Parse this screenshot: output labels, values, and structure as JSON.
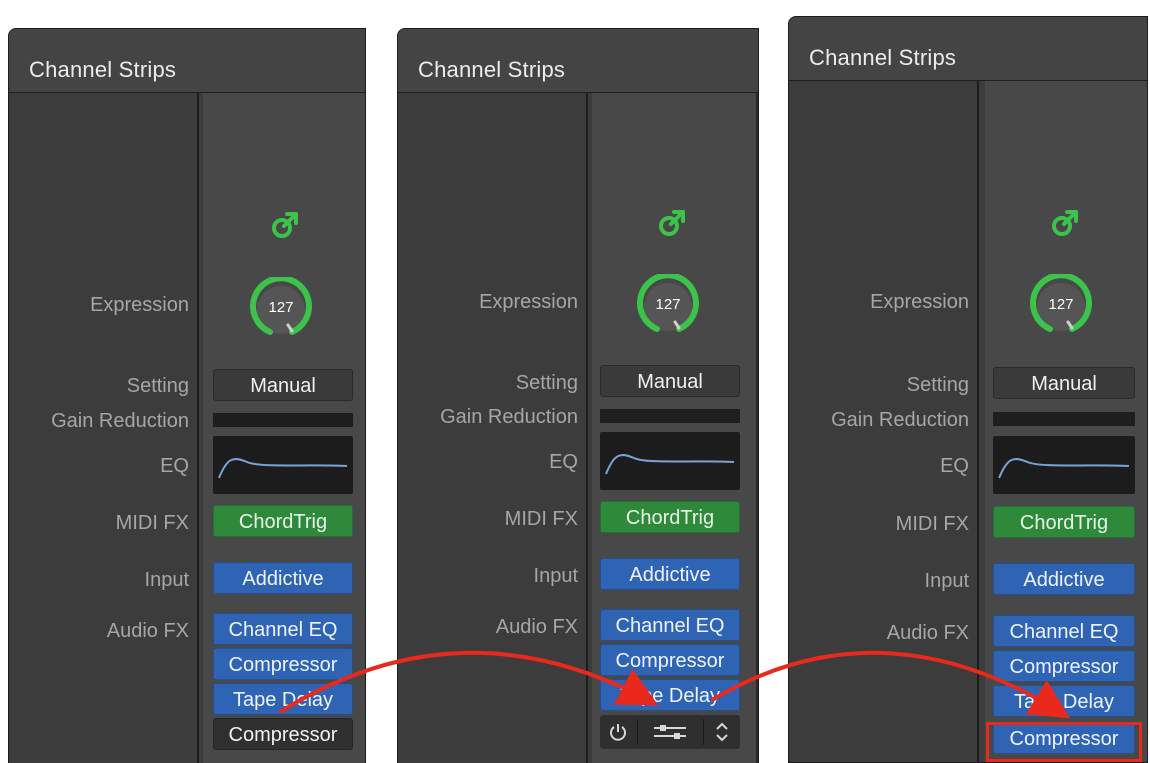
{
  "panel_title": "Channel Strips",
  "labels": {
    "expression": "Expression",
    "setting": "Setting",
    "gain_reduction": "Gain Reduction",
    "eq": "EQ",
    "midi_fx": "MIDI FX",
    "input": "Input",
    "audio_fx": "Audio FX"
  },
  "strip": {
    "expression_value": "127",
    "setting_value": "Manual",
    "midi_fx_slot": "ChordTrig",
    "input_slot": "Addictive",
    "audio_fx_slots": [
      "Channel EQ",
      "Compressor",
      "Tape Delay"
    ],
    "dragged_plugin": "Compressor"
  },
  "icons": {
    "io": "input-output-arrow-icon",
    "power": "power-icon",
    "sliders": "sliders-icon",
    "updown": "up-down-chevron-icon"
  },
  "colors": {
    "green_accent": "#3cc34a",
    "blue_slot": "#2f64b4",
    "green_slot": "#2e8a3a",
    "annotation_red": "#e8291c"
  }
}
